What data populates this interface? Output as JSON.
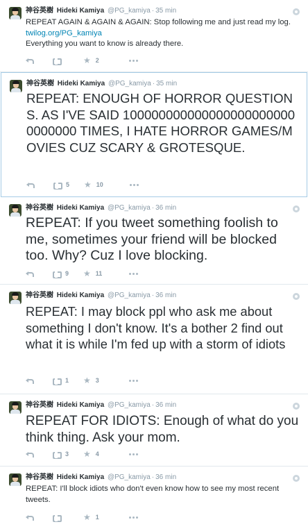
{
  "tweets": [
    {
      "name_jp": "神谷英樹",
      "name": "Hideki Kamiya",
      "handle": "@PG_kamiya",
      "time": "35 min",
      "text_before_link": "REPEAT AGAIN & AGAIN & AGAIN: Stop following me and just read my log. ",
      "link": "twilog.org/PG_kamiya",
      "text_after_link": "Everything you want to know is already there.",
      "retweets": "",
      "favorites": "2"
    },
    {
      "name_jp": "神谷英樹",
      "name": "Hideki Kamiya",
      "handle": "@PG_kamiya",
      "time": "35 min",
      "text": "REPEAT: ENOUGH OF HORROR QUESTIONS. AS I'VE SAID 1000000000000000000000000000000 TIMES, I HATE HORROR GAMES/MOVIES CUZ SCARY & GROTESQUE.",
      "retweets": "5",
      "favorites": "10"
    },
    {
      "name_jp": "神谷英樹",
      "name": "Hideki Kamiya",
      "handle": "@PG_kamiya",
      "time": "36 min",
      "text": "REPEAT: If you tweet something foolish to me, sometimes your friend will be blocked too. Why? Cuz I love blocking.",
      "retweets": "9",
      "favorites": "11"
    },
    {
      "name_jp": "神谷英樹",
      "name": "Hideki Kamiya",
      "handle": "@PG_kamiya",
      "time": "36 min",
      "text": "REPEAT: I may block ppl who ask me about something I don't know. It's a bother 2 find out what it is while I'm fed up with a storm of idiots",
      "retweets": "1",
      "favorites": "3"
    },
    {
      "name_jp": "神谷英樹",
      "name": "Hideki Kamiya",
      "handle": "@PG_kamiya",
      "time": "36 min",
      "text": "REPEAT FOR IDIOTS: Enough of what do you think thing. Ask your mom.",
      "retweets": "3",
      "favorites": "4"
    },
    {
      "name_jp": "神谷英樹",
      "name": "Hideki Kamiya",
      "handle": "@PG_kamiya",
      "time": "36 min",
      "text": "REPEAT: I'll block idiots who don't even know how to see my most recent tweets.",
      "retweets": "",
      "favorites": "1"
    }
  ],
  "colors": {
    "link": "#0084b4",
    "meta": "#8899a6",
    "icon": "#aab8c2",
    "focused_border": "#a5cce6"
  },
  "icons": [
    "reply-icon",
    "retweet-icon",
    "favorite-icon",
    "more-icon",
    "gear-icon"
  ]
}
